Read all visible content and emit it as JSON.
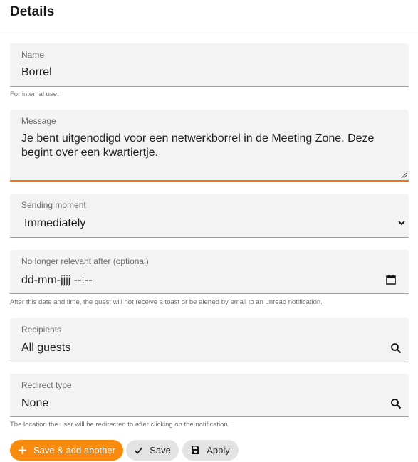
{
  "header": {
    "title": "Details"
  },
  "fields": {
    "name": {
      "label": "Name",
      "value": "Borrel",
      "hint": "For internal use."
    },
    "message": {
      "label": "Message",
      "value": "Je bent uitgenodigd voor een netwerkborrel in de Meeting Zone. Deze begint over een kwartiertje."
    },
    "sending_moment": {
      "label": "Sending moment",
      "value": "Immediately"
    },
    "expiry": {
      "label": "No longer relevant after (optional)",
      "placeholder": "dd-mm-jjjj --:--",
      "hint": "After this date and time, the guest will not receive a toast or be alerted by email to an unread notification."
    },
    "recipients": {
      "label": "Recipients",
      "value": "All guests"
    },
    "redirect_type": {
      "label": "Redirect type",
      "value": "None",
      "hint": "The location the user will be redirected to after clicking on the notification."
    }
  },
  "actions": {
    "save_add": "Save & add another",
    "save": "Save",
    "apply": "Apply"
  },
  "colors": {
    "accent": "#f68b0f",
    "field_bg": "#f3f3f3"
  }
}
